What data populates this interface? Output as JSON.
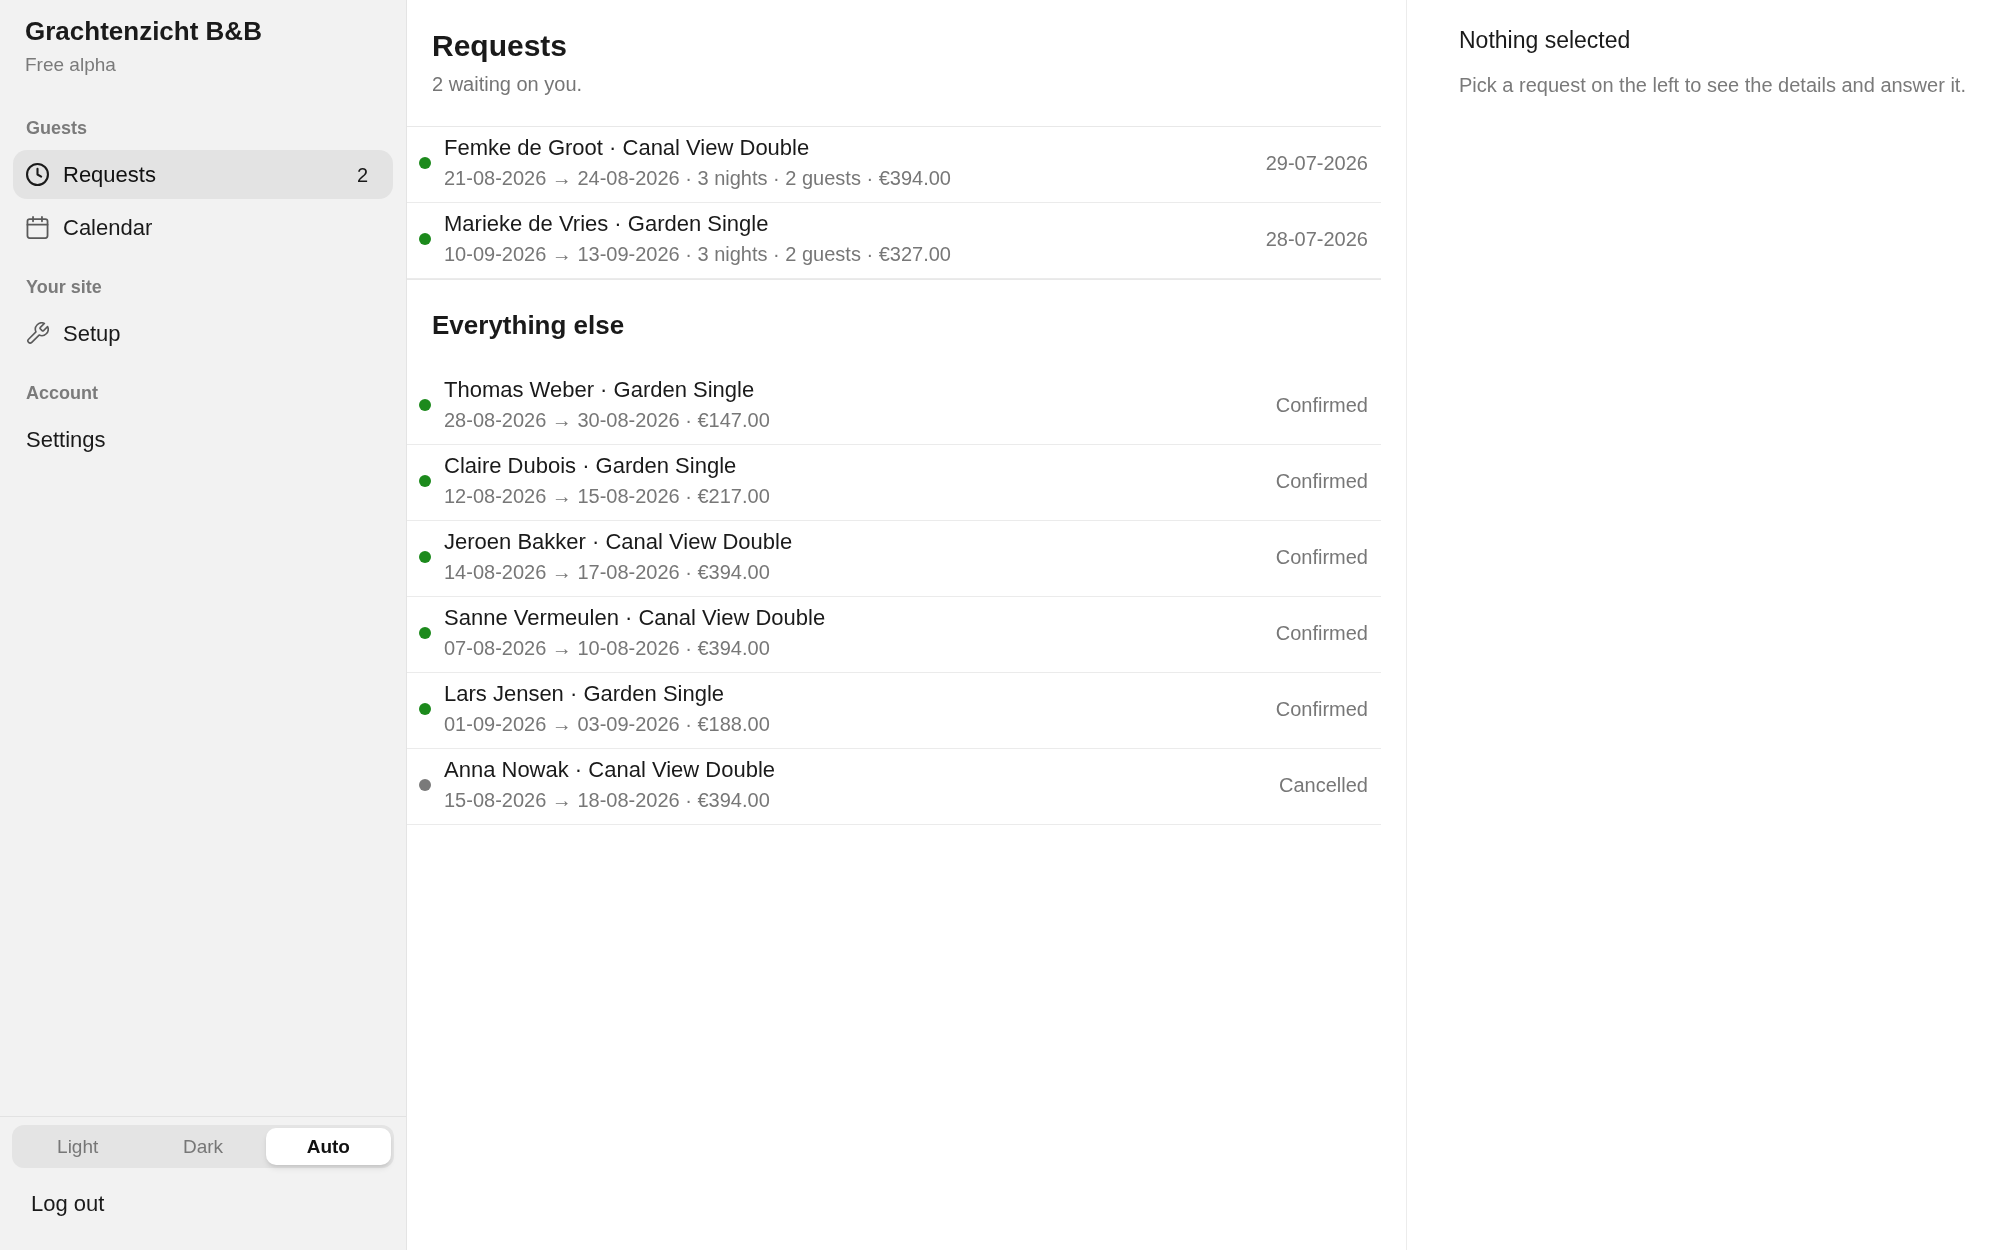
{
  "sidebar": {
    "brand": "Grachtenzicht B&B",
    "plan": "Free alpha",
    "sections": [
      {
        "heading": "Guests",
        "items": [
          {
            "label": "Requests",
            "count": "2",
            "selected": true
          },
          {
            "label": "Calendar",
            "selected": false
          }
        ]
      },
      {
        "heading": "Your site",
        "items": [
          {
            "label": "Setup",
            "selected": false
          }
        ]
      },
      {
        "heading": "Account",
        "items": [
          {
            "label": "Settings",
            "selected": false
          }
        ]
      }
    ],
    "theme_options": [
      {
        "label": "Light",
        "selected": false
      },
      {
        "label": "Dark",
        "selected": false
      },
      {
        "label": "Auto",
        "selected": true
      }
    ],
    "logout": "Log out"
  },
  "requests": {
    "title": "Requests",
    "subtitle": "2 waiting on you.",
    "items": [
      {
        "title": "Femke de Groot · Canal View Double",
        "details": "21-08-2026 → 24-08-2026 · 3 nights · 2 guests · €394.00",
        "date": "29-07-2026",
        "color": "#1c8a1c"
      },
      {
        "title": "Marieke de Vries · Garden Single",
        "details": "10-09-2026 → 13-09-2026 · 3 nights · 2 guests · €327.00",
        "date": "28-07-2026",
        "color": "#1c8a1c"
      }
    ]
  },
  "everything_else": {
    "title": "Everything else",
    "items": [
      {
        "title": "Thomas Weber · Garden Single",
        "details": "28-08-2026 → 30-08-2026 · €147.00",
        "status": "Confirmed",
        "color": "#1c8a1c"
      },
      {
        "title": "Claire Dubois · Garden Single",
        "details": "12-08-2026 → 15-08-2026 · €217.00",
        "status": "Confirmed",
        "color": "#1c8a1c"
      },
      {
        "title": "Jeroen Bakker · Canal View Double",
        "details": "14-08-2026 → 17-08-2026 · €394.00",
        "status": "Confirmed",
        "color": "#1c8a1c"
      },
      {
        "title": "Sanne Vermeulen · Canal View Double",
        "details": "07-08-2026 → 10-08-2026 · €394.00",
        "status": "Confirmed",
        "color": "#1c8a1c"
      },
      {
        "title": "Lars Jensen · Garden Single",
        "details": "01-09-2026 → 03-09-2026 · €188.00",
        "status": "Confirmed",
        "color": "#1c8a1c"
      },
      {
        "title": "Anna Nowak · Canal View Double",
        "details": "15-08-2026 → 18-08-2026 · €394.00",
        "status": "Cancelled",
        "color": "#7a7a7a"
      }
    ]
  },
  "detail": {
    "title": "Nothing selected",
    "text": "Pick a request on the left to see the details and answer it."
  }
}
